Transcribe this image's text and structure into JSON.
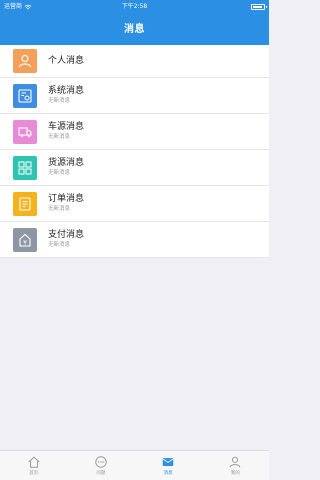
{
  "status_bar": {
    "carrier": "运营商",
    "time": "下午2:58"
  },
  "navbar": {
    "title": "消息"
  },
  "messages": [
    {
      "title": "个人消息",
      "subtitle": "",
      "color": "#f5a05a",
      "icon": "person-icon"
    },
    {
      "title": "系统消息",
      "subtitle": "无新消息",
      "color": "#3f8de0",
      "icon": "system-icon"
    },
    {
      "title": "车源消息",
      "subtitle": "无新消息",
      "color": "#e98ad6",
      "icon": "truck-icon"
    },
    {
      "title": "货源消息",
      "subtitle": "无新消息",
      "color": "#2fc3b2",
      "icon": "cargo-icon"
    },
    {
      "title": "订单消息",
      "subtitle": "无新消息",
      "color": "#f3b21e",
      "icon": "order-icon"
    },
    {
      "title": "支付消息",
      "subtitle": "无新消息",
      "color": "#8d97a3",
      "icon": "payment-icon"
    }
  ],
  "tabbar": {
    "items": [
      {
        "label": "首页",
        "icon": "home-icon",
        "active": false
      },
      {
        "label": "问题",
        "icon": "chat-icon",
        "active": false
      },
      {
        "label": "消息",
        "icon": "message-icon",
        "active": true
      },
      {
        "label": "我的",
        "icon": "user-icon",
        "active": false
      }
    ]
  },
  "colors": {
    "primary": "#2b8fe3",
    "background": "#efeff4"
  }
}
